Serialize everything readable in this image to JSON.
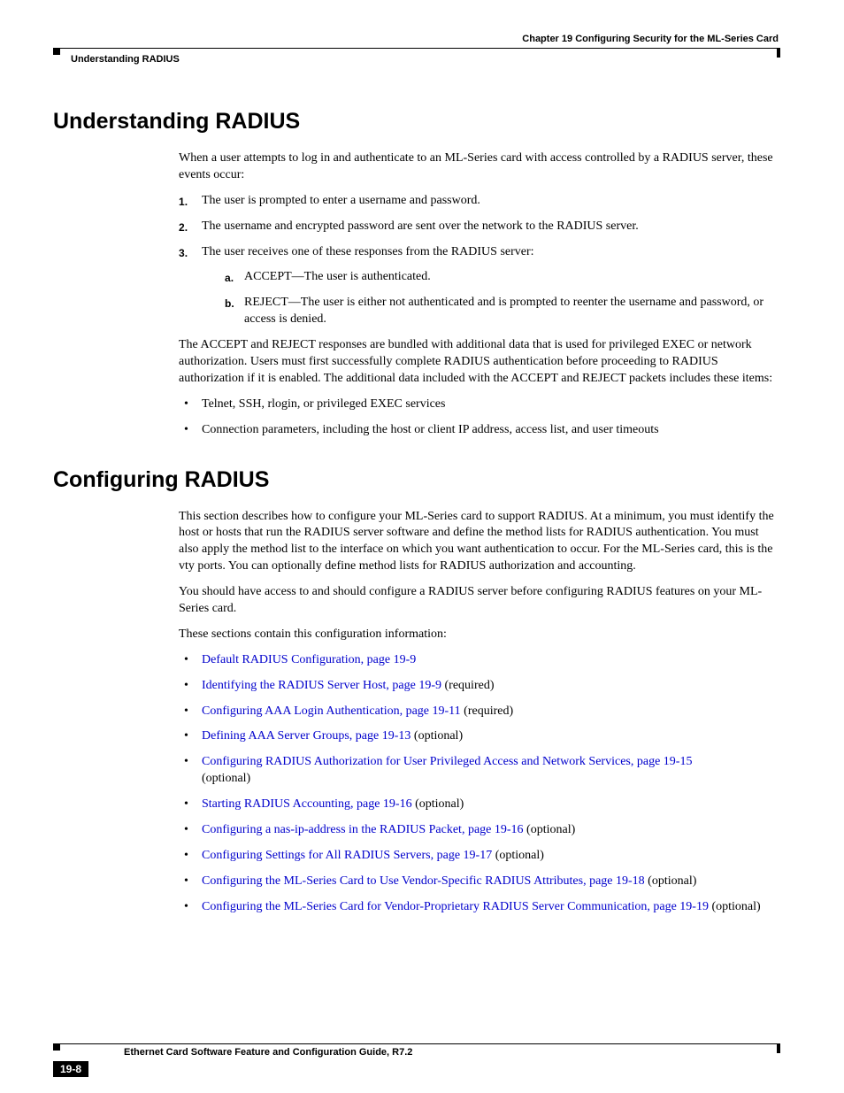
{
  "header": {
    "chapter_title": "Chapter 19      Configuring Security for the ML-Series Card",
    "section_label": "Understanding RADIUS"
  },
  "section1": {
    "title": "Understanding RADIUS",
    "intro": "When a user attempts to log in and authenticate to an ML-Series card with access controlled by a RADIUS server, these events occur:",
    "steps": {
      "s1": "The user is prompted to enter a username and password.",
      "s2": "The username and encrypted password are sent over the network to the RADIUS server.",
      "s3": "The user receives one of these responses from the RADIUS server:",
      "s3a": "ACCEPT—The user is authenticated.",
      "s3b": "REJECT—The user is either not authenticated and is prompted to reenter the username and password, or access is denied."
    },
    "para2": "The ACCEPT and REJECT responses are bundled with additional data that is used for privileged EXEC or network authorization. Users must first successfully complete RADIUS authentication before proceeding to RADIUS authorization if it is enabled. The additional data included with the ACCEPT and REJECT packets includes these items:",
    "bullets": {
      "b1": "Telnet, SSH, rlogin, or privileged EXEC services",
      "b2": "Connection parameters, including the host or client IP address, access list, and user timeouts"
    }
  },
  "section2": {
    "title": "Configuring RADIUS",
    "para1": "This section describes how to configure your ML-Series card to support RADIUS. At a minimum, you must identify the host or hosts that run the RADIUS server software and define the method lists for RADIUS authentication. You must also apply the method list to the interface on which you want authentication to occur. For the ML-Series card, this is the vty ports. You can optionally define method lists for RADIUS authorization and accounting.",
    "para2": "You should have access to and should configure a RADIUS server before configuring RADIUS features on your ML-Series card.",
    "para3": "These sections contain this configuration information:",
    "links": {
      "l1": "Default RADIUS Configuration, page 19-9",
      "l2": "Identifying the RADIUS Server Host, page 19-9",
      "l2s": " (required)",
      "l3": "Configuring AAA Login Authentication, page 19-11",
      "l3s": " (required)",
      "l4": "Defining AAA Server Groups, page 19-13",
      "l4s": " (optional)",
      "l5": "Configuring RADIUS Authorization for User Privileged Access and Network Services, page 19-15",
      "l5s": "(optional)",
      "l6": "Starting RADIUS Accounting, page 19-16",
      "l6s": " (optional)",
      "l7": "Configuring a nas-ip-address in the RADIUS Packet, page 19-16",
      "l7s": " (optional)",
      "l8": "Configuring Settings for All RADIUS Servers, page 19-17",
      "l8s": " (optional)",
      "l9": "Configuring the ML-Series Card to Use Vendor-Specific RADIUS Attributes, page 19-18",
      "l9s": " (optional)",
      "l10": "Configuring the ML-Series Card for Vendor-Proprietary RADIUS Server Communication, page 19-19",
      "l10s": " (optional)"
    }
  },
  "footer": {
    "guide_title": "Ethernet Card Software Feature and Configuration Guide, R7.2",
    "page_num": "19-8"
  }
}
